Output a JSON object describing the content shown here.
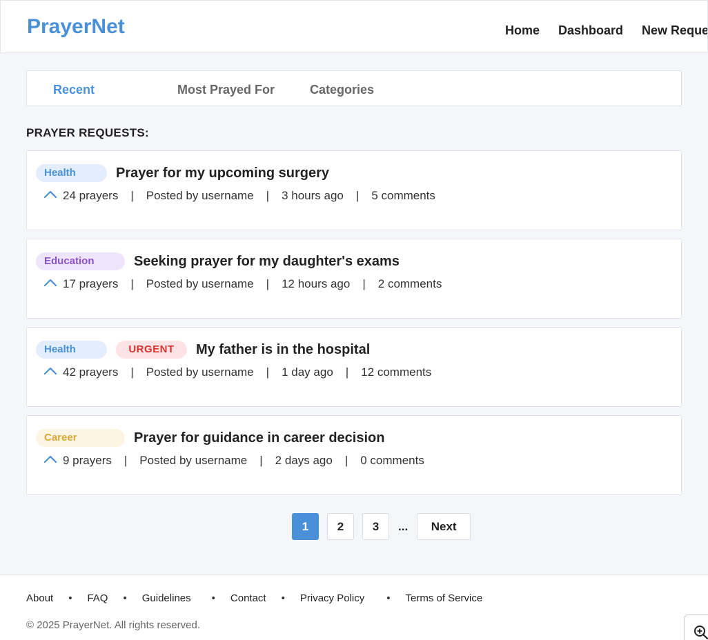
{
  "header": {
    "logo": "PrayerNet",
    "nav": [
      "Home",
      "Dashboard",
      "New Request"
    ]
  },
  "tabs": [
    {
      "label": "Recent",
      "active": true
    },
    {
      "label": "Most Prayed For",
      "active": false
    },
    {
      "label": "Categories",
      "active": false
    }
  ],
  "section_title": "PRAYER REQUESTS:",
  "requests": [
    {
      "category": "Health",
      "title": "Prayer for my upcoming surgery",
      "prayers": "24 prayers",
      "posted_by": "Posted by username",
      "time": "3 hours ago",
      "comments": "5 comments"
    },
    {
      "category": "Education",
      "title": "Seeking prayer for my daughter's exams",
      "prayers": "17 prayers",
      "posted_by": "Posted by username",
      "time": "12 hours ago",
      "comments": "2 comments"
    },
    {
      "category": "Health",
      "urgent": "URGENT",
      "title": "My father is in the hospital",
      "prayers": "42 prayers",
      "posted_by": "Posted by username",
      "time": "1 day ago",
      "comments": "12 comments"
    },
    {
      "category": "Career",
      "title": "Prayer for guidance in career decision",
      "prayers": "9 prayers",
      "posted_by": "Posted by username",
      "time": "2 days ago",
      "comments": "0 comments"
    }
  ],
  "separator": "|",
  "pagination": {
    "pages": [
      "1",
      "2",
      "3"
    ],
    "current": "1",
    "ellipsis": "...",
    "next": "Next"
  },
  "footer": {
    "links": [
      "About",
      "FAQ",
      "Guidelines",
      "Contact",
      "Privacy Policy",
      "Terms of Service"
    ],
    "bullet": "•",
    "copyright": "© 2025 PrayerNet. All rights reserved."
  },
  "colors": {
    "accent": "#4a90d9",
    "urgent": "#d93030",
    "education": "#8a52c9",
    "career": "#dba93a"
  },
  "icons": {
    "upvote": "chevron-up-icon",
    "zoom": "zoom-in-icon"
  }
}
